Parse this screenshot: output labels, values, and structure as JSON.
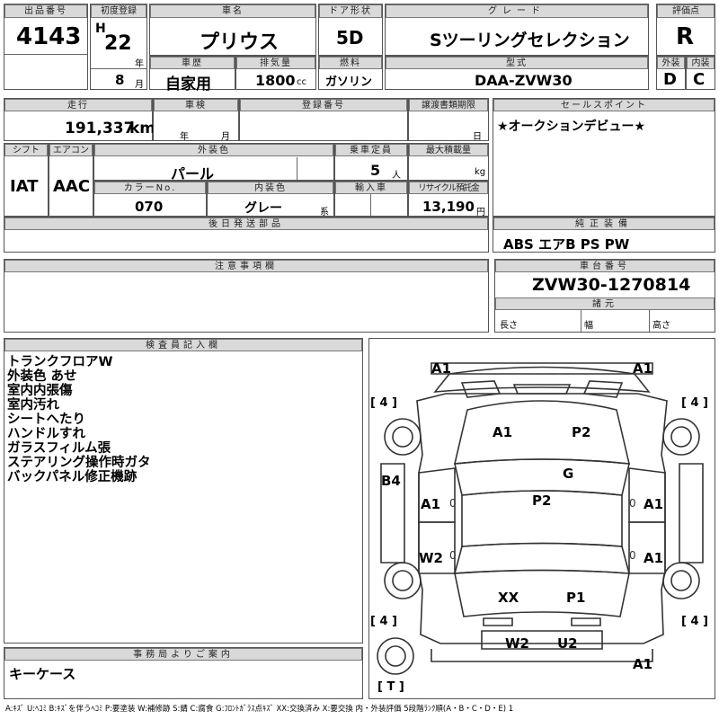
{
  "lot": {
    "label": "出品番号",
    "value": "4143"
  },
  "first_reg": {
    "label": "初度登録",
    "era": "H",
    "year": "22",
    "year_unit": "年",
    "month": "8",
    "month_unit": "月"
  },
  "car_name": {
    "label": "車名",
    "value": "プリウス"
  },
  "door": {
    "label": "ドア形状",
    "value": "5D"
  },
  "grade": {
    "label": "グレード",
    "value": "Sツーリングセレクション"
  },
  "score": {
    "label": "評価点",
    "value": "R"
  },
  "history": {
    "label": "車歴",
    "value": "自家用"
  },
  "displacement": {
    "label": "排気量",
    "value": "1800",
    "unit": "cc"
  },
  "fuel": {
    "label": "燃料",
    "value": "ガソリン"
  },
  "model": {
    "label": "型式",
    "value": "DAA-ZVW30"
  },
  "exterior_grade": {
    "label": "外装",
    "value": "D"
  },
  "interior_grade": {
    "label": "内装",
    "value": "C"
  },
  "mileage": {
    "label": "走行",
    "value": "191,337",
    "unit": "km"
  },
  "inspection": {
    "label": "車検",
    "year_unit": "年",
    "month_unit": "月"
  },
  "reg_no": {
    "label": "登録番号"
  },
  "transfer": {
    "label": "譲渡書類期限",
    "day_unit": "日"
  },
  "sales_point": {
    "label": "セールスポイント",
    "value": "★オークションデビュー★"
  },
  "shift": {
    "label": "シフト",
    "value": "IAT"
  },
  "aircon": {
    "label": "エアコン",
    "value": "AAC"
  },
  "ext_color": {
    "label": "外装色",
    "value": "パール"
  },
  "capacity": {
    "label": "乗車定員",
    "value": "5",
    "unit": "人"
  },
  "max_load": {
    "label": "最大積載量",
    "unit": "kg"
  },
  "color_no": {
    "label": "カラーNo.",
    "value": "070"
  },
  "int_color": {
    "label": "内装色",
    "value": "グレー",
    "unit": "系"
  },
  "import": {
    "label": "輸入車"
  },
  "recycle": {
    "label": "リサイクル預託金",
    "value": "13,190",
    "unit": "円"
  },
  "later_parts": {
    "label": "後日発送部品"
  },
  "equipment": {
    "label": "純正装備",
    "value": "ABS エアB PS PW"
  },
  "notes": {
    "label": "注意事項欄"
  },
  "chassis": {
    "label": "車台番号",
    "value": "ZVW30-1270814"
  },
  "specs": {
    "label": "諸元",
    "length": "長さ",
    "width": "幅",
    "height": "高さ"
  },
  "inspector": {
    "label": "検査員記入欄",
    "lines": [
      "トランクフロアW",
      "外装色 あせ",
      "室内内張傷",
      "室内汚れ",
      "シートへたり",
      "ハンドルすれ",
      "ガラスフィルム張",
      "ステアリング操作時ガタ",
      "バックパネル修正機跡"
    ]
  },
  "office": {
    "label": "事務局よりご案内",
    "value": "キーケース"
  },
  "diagram": {
    "marks": {
      "front_left_corner": "A1",
      "front_right_corner": "A1",
      "hood_left": "A1",
      "hood_right": "P2",
      "windshield": "G",
      "left_fender": "B4",
      "left_front_door": "A1",
      "left_rear_door": "W2",
      "right_front_door": "A1",
      "right_rear_door": "A1",
      "roof": "P2",
      "trunk_left": "XX",
      "trunk_right": "P1",
      "rear_left": "W2",
      "rear_right": "U2",
      "rear_right_corner": "A1"
    },
    "tire_label": "[ 4 ]",
    "spare_label": "[ T ]"
  },
  "legend": "A:ｷｽﾞ U:ﾍｺﾐ B:ｷｽﾞを伴うﾍｺﾐ P:要塗装 W:補修跡 S:錆 C:腐食 G:ﾌﾛﾝﾄｶﾞﾗｽ点ｷｽﾞ XX:交換済み X:要交換  内・外装評価 5段階ﾗﾝｸ順(A・B・C・D・E) 1"
}
